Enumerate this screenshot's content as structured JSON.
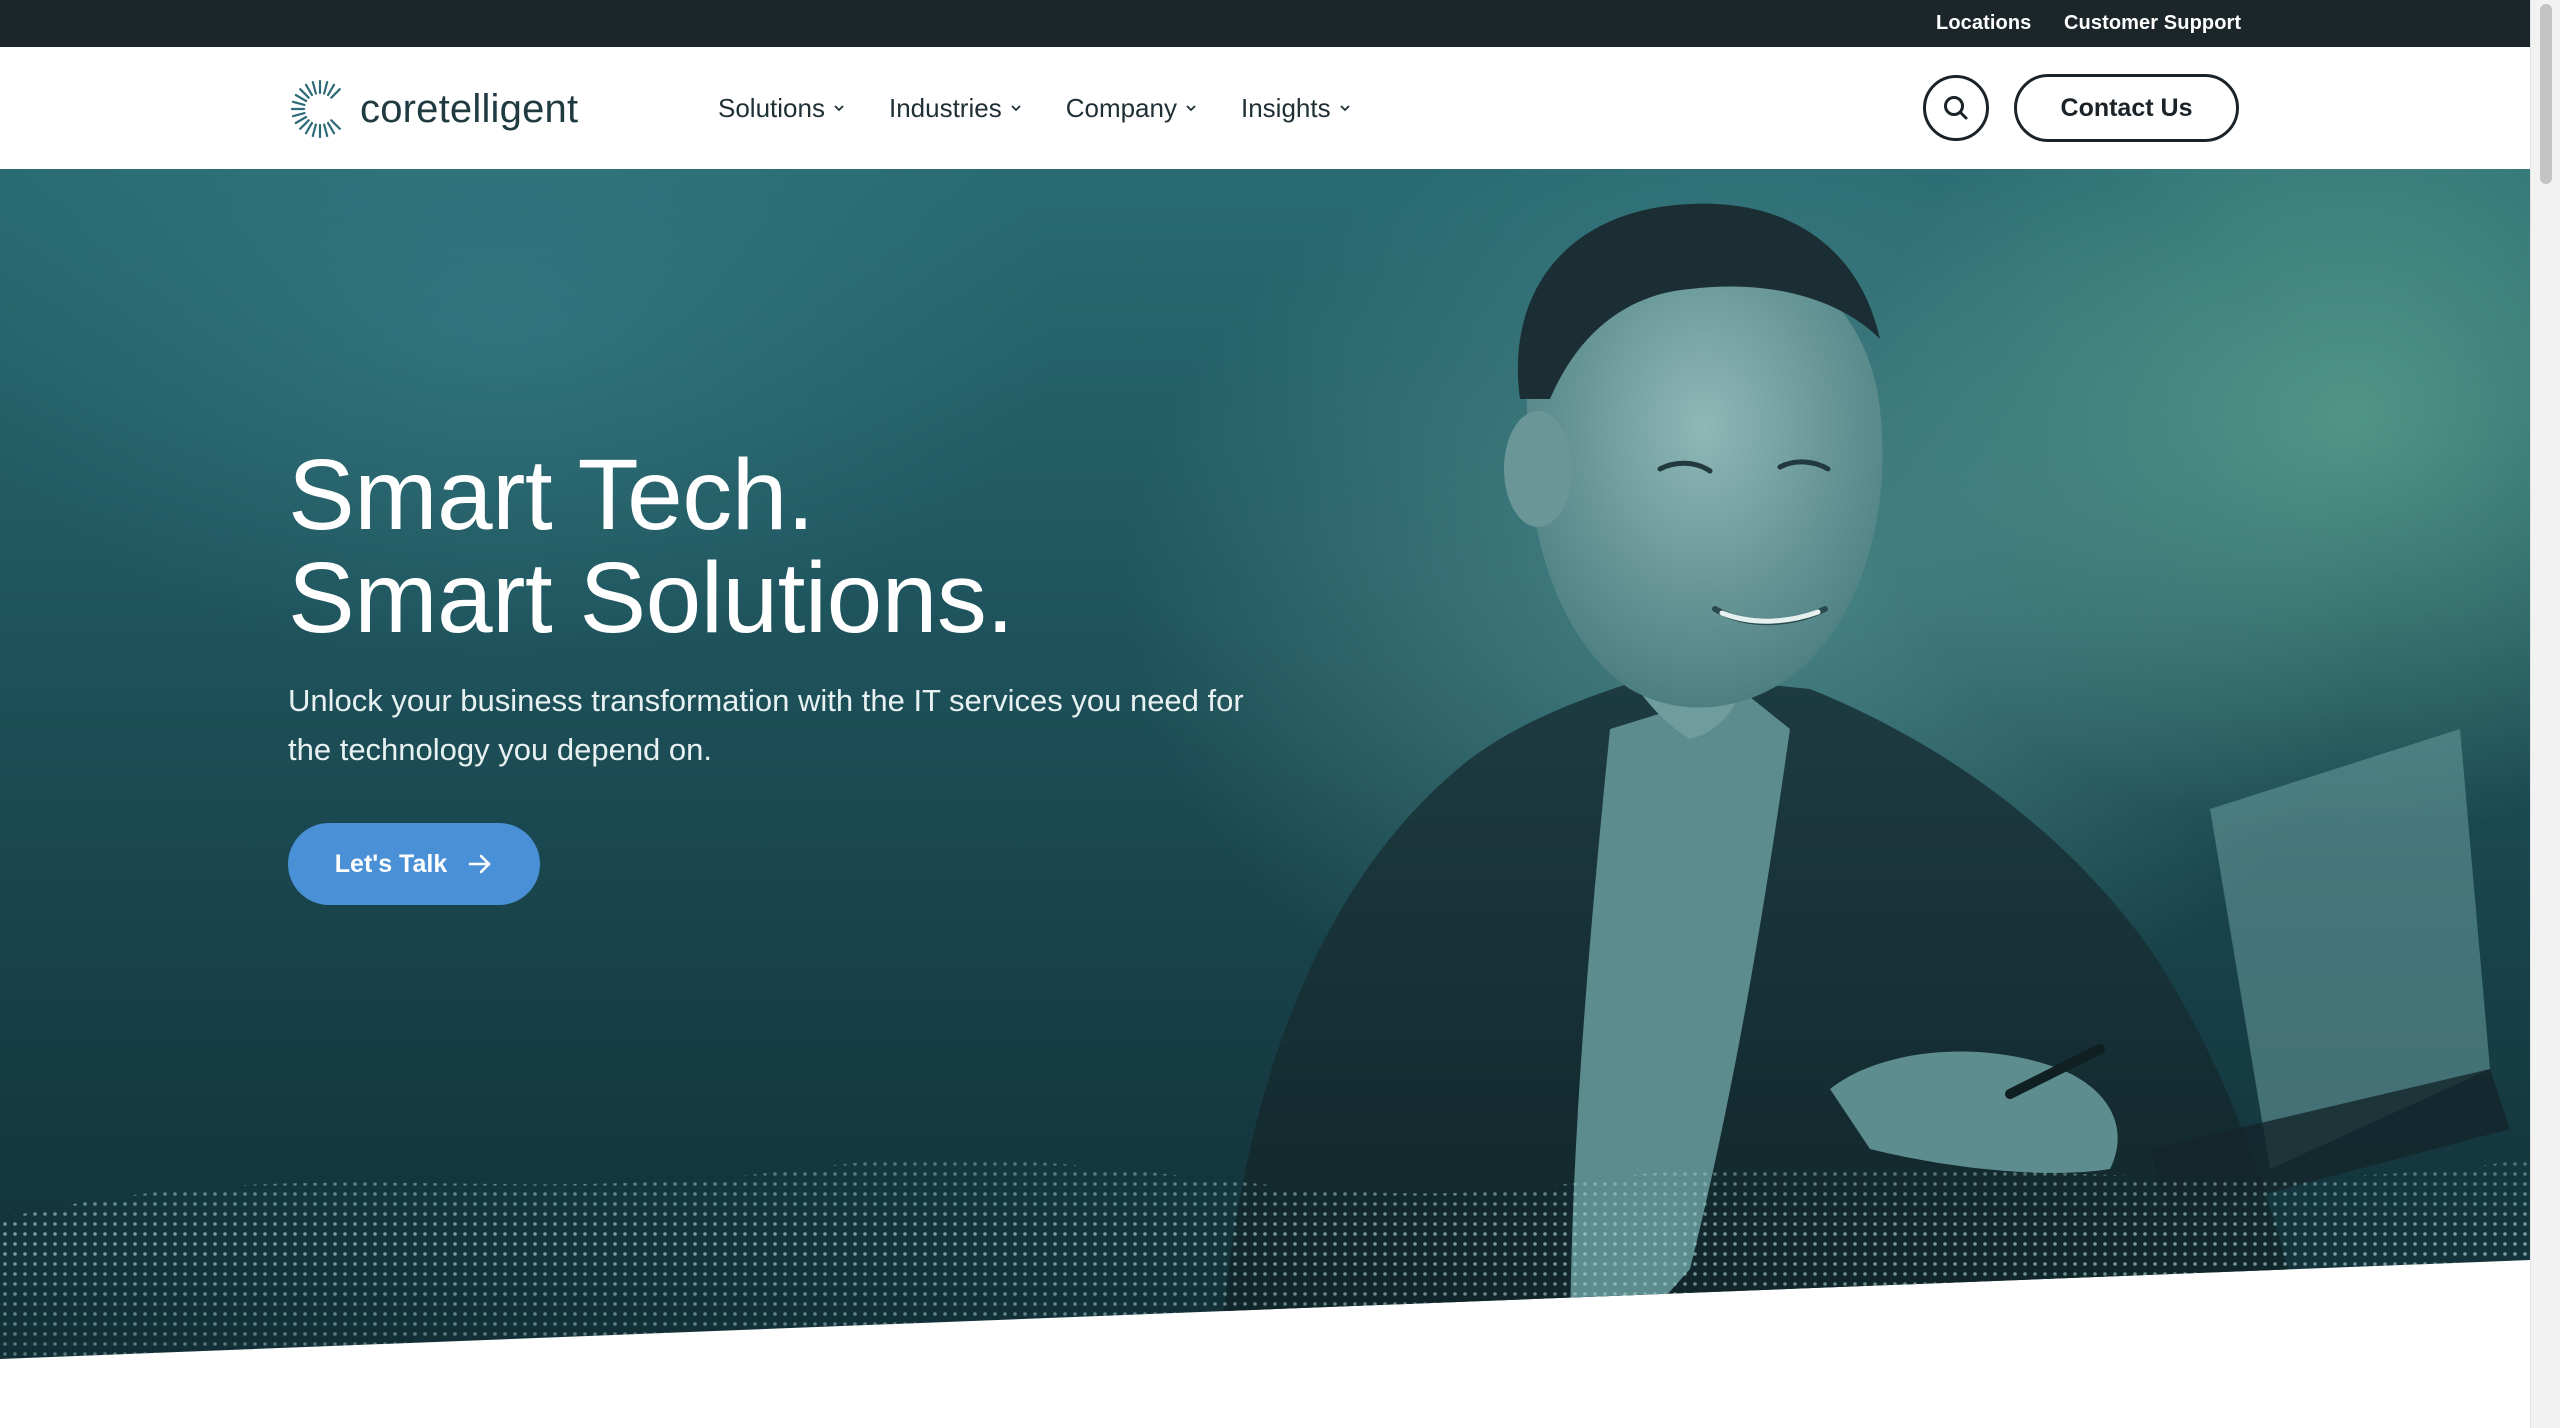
{
  "utility_nav": {
    "locations": "Locations",
    "support": "Customer Support"
  },
  "brand": {
    "name": "coretelligent",
    "color": "#1f3a40"
  },
  "nav": {
    "items": [
      {
        "label": "Solutions"
      },
      {
        "label": "Industries"
      },
      {
        "label": "Company"
      },
      {
        "label": "Insights"
      }
    ]
  },
  "header_actions": {
    "search_icon": "search-icon",
    "contact_label": "Contact Us"
  },
  "hero": {
    "title_line1": "Smart Tech.",
    "title_line2": "Smart Solutions.",
    "subtitle": "Unlock your business transformation with the IT services you need for the technology you depend on.",
    "cta_label": "Let's Talk",
    "cta_color": "#4a90d6",
    "cta_icon": "arrow-right-icon"
  }
}
